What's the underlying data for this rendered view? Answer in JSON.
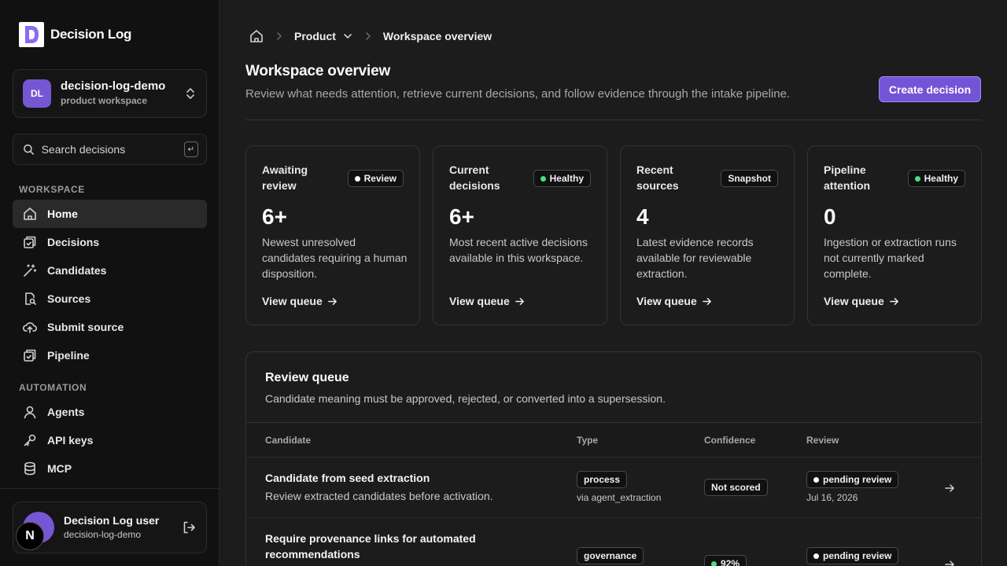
{
  "app": {
    "name": "Decision Log",
    "logo_letter": "D"
  },
  "workspace_switcher": {
    "initials": "DL",
    "name": "decision-log-demo",
    "subtitle": "product workspace"
  },
  "search": {
    "placeholder": "Search decisions",
    "shortcut": "↵"
  },
  "sidebar": {
    "workspace_label": "WORKSPACE",
    "workspace_items": [
      {
        "label": "Home",
        "icon": "home-icon",
        "active": true
      },
      {
        "label": "Decisions",
        "icon": "decisions-icon"
      },
      {
        "label": "Candidates",
        "icon": "wand-icon"
      },
      {
        "label": "Sources",
        "icon": "file-search-icon"
      },
      {
        "label": "Submit source",
        "icon": "upload-icon"
      },
      {
        "label": "Pipeline",
        "icon": "pipeline-icon"
      }
    ],
    "automation_label": "AUTOMATION",
    "automation_items": [
      {
        "label": "Agents",
        "icon": "user-icon"
      },
      {
        "label": "API keys",
        "icon": "key-icon"
      },
      {
        "label": "MCP",
        "icon": "database-icon"
      }
    ]
  },
  "user": {
    "name": "Decision Log user",
    "workspace": "decision-log-demo",
    "badge_letter": "N"
  },
  "breadcrumb": {
    "section": "Product",
    "current": "Workspace overview"
  },
  "page": {
    "title": "Workspace overview",
    "description": "Review what needs attention, retrieve current decisions, and follow evidence through the intake pipeline.",
    "create_button": "Create decision"
  },
  "stats": [
    {
      "title": "Awaiting review",
      "badge": "Review",
      "badge_dot": "#ffffff",
      "value": "6+",
      "description": "Newest unresolved candidates requiring a human disposition.",
      "link": "View queue"
    },
    {
      "title": "Current decisions",
      "badge": "Healthy",
      "badge_dot": "#4ade80",
      "value": "6+",
      "description": "Most recent active decisions available in this workspace.",
      "link": "View queue"
    },
    {
      "title": "Recent sources",
      "badge": "Snapshot",
      "badge_dot": "",
      "value": "4",
      "description": "Latest evidence records available for reviewable extraction.",
      "link": "View queue"
    },
    {
      "title": "Pipeline attention",
      "badge": "Healthy",
      "badge_dot": "#4ade80",
      "value": "0",
      "description": "Ingestion or extraction runs not currently marked complete.",
      "link": "View queue"
    }
  ],
  "review_queue": {
    "title": "Review queue",
    "description": "Candidate meaning must be approved, rejected, or converted into a supersession.",
    "columns": [
      "Candidate",
      "Type",
      "Confidence",
      "Review"
    ],
    "rows": [
      {
        "title": "Candidate from seed extraction",
        "description": "Review extracted candidates before activation.",
        "type": "process",
        "via": "via agent_extraction",
        "confidence": "Not scored",
        "confidence_dot": "",
        "status": "pending review",
        "date": "Jul 16, 2026"
      },
      {
        "title": "Require provenance links for automated recommendations",
        "description": "",
        "type": "governance",
        "via": "",
        "confidence": "92%",
        "confidence_dot": "#4ade80",
        "status": "pending review",
        "date": ""
      }
    ]
  },
  "colors": {
    "accent": "#7454d6",
    "healthy": "#4ade80",
    "sidebar_bg": "#111111",
    "main_bg": "#1c1c1c"
  }
}
